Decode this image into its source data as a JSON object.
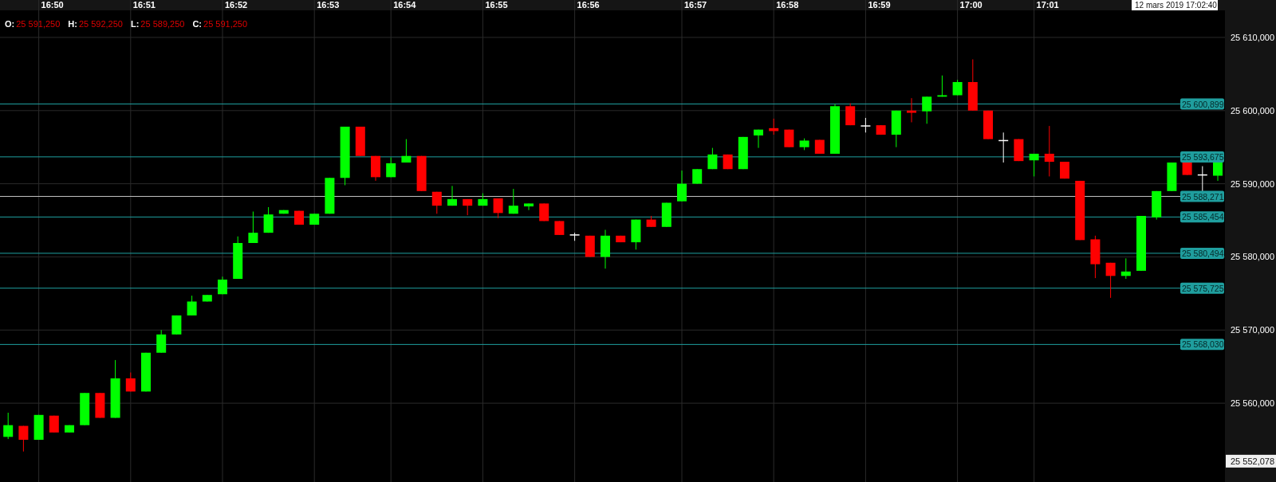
{
  "header": {
    "ohlc": [
      {
        "label": "O:",
        "value": "25 591,250"
      },
      {
        "label": "H:",
        "value": "25 592,250"
      },
      {
        "label": "L:",
        "value": "25 589,250"
      },
      {
        "label": "C:",
        "value": "25 591,250"
      }
    ]
  },
  "cursor": {
    "time": "12 mars 2019 17:02:40",
    "price": "25 552,078"
  },
  "price_levels": [
    {
      "label": "25 600,899",
      "kind": "level"
    },
    {
      "label": "25 593,675",
      "kind": "level"
    },
    {
      "label": "25 588,271",
      "kind": "cursor"
    },
    {
      "label": "25 585,454",
      "kind": "level"
    },
    {
      "label": "25 580,494",
      "kind": "level"
    },
    {
      "label": "25 575,725",
      "kind": "level"
    },
    {
      "label": "25 568,030",
      "kind": "level"
    }
  ],
  "time_axis": [
    "16:50",
    "16:51",
    "16:52",
    "16:53",
    "16:54",
    "16:55",
    "16:56",
    "16:57",
    "16:58",
    "16:59",
    "17:00",
    "17:01"
  ],
  "price_axis": [
    "25 610,000",
    "25 600,000",
    "25 590,000",
    "25 580,000",
    "25 570,000",
    "25 560,000"
  ]
}
